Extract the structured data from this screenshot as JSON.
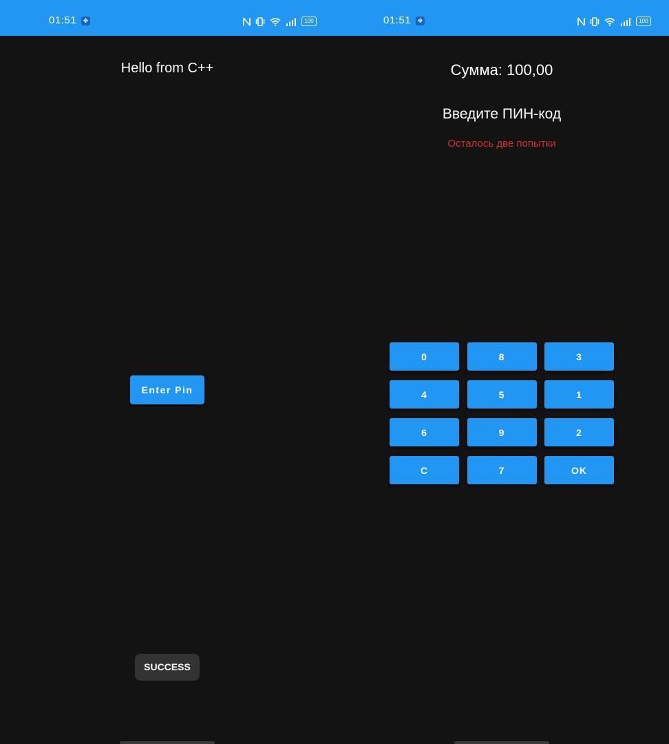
{
  "left_screen": {
    "status_bar": {
      "time": "01:51",
      "battery": "100"
    },
    "greeting": "Hello from C++",
    "enter_pin_button": "Enter Pin",
    "toast": "SUCCESS"
  },
  "right_screen": {
    "status_bar": {
      "time": "01:51",
      "battery": "100"
    },
    "sum_label": "Сумма: 100,00",
    "pin_prompt": "Введите ПИН-код",
    "attempts_warning": "Осталось две попытки",
    "keypad": [
      "0",
      "8",
      "3",
      "4",
      "5",
      "1",
      "6",
      "9",
      "2",
      "C",
      "7",
      "OK"
    ]
  },
  "colors": {
    "accent": "#2196f3",
    "background": "#131313",
    "warning": "#d32f2f",
    "toast": "#333333"
  },
  "icons": [
    "nfc-icon",
    "vibrate-icon",
    "wifi-icon",
    "signal-icon",
    "battery-icon",
    "usb-debug-icon"
  ]
}
